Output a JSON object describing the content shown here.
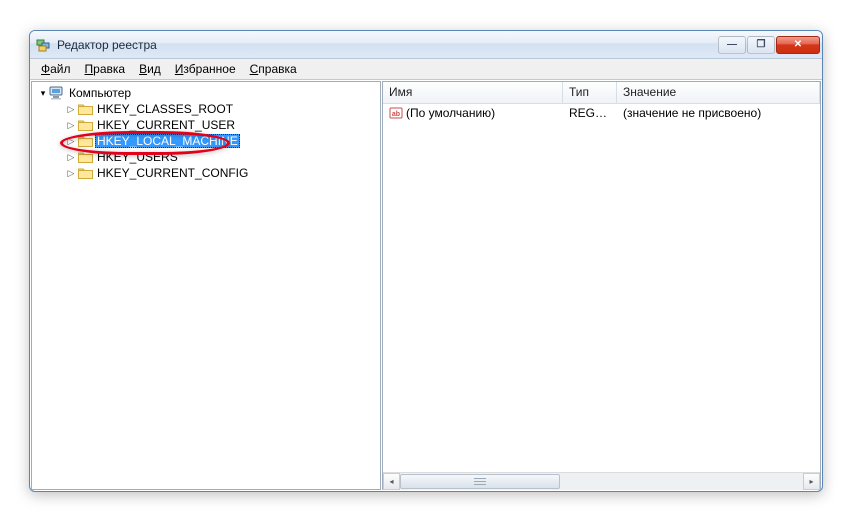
{
  "window": {
    "title": "Редактор реестра"
  },
  "window_controls": {
    "minimize_icon": "—",
    "maximize_icon": "❐",
    "close_icon": "✕"
  },
  "menu": {
    "file": {
      "ul": "Ф",
      "rest": "айл"
    },
    "edit": {
      "ul": "П",
      "rest": "равка"
    },
    "view": {
      "ul": "В",
      "rest": "ид"
    },
    "favorites": {
      "ul": "И",
      "rest": "збранное"
    },
    "help": {
      "ul": "С",
      "rest": "правка"
    }
  },
  "tree": {
    "root": "Компьютер",
    "items": [
      "HKEY_CLASSES_ROOT",
      "HKEY_CURRENT_USER",
      "HKEY_LOCAL_MACHINE",
      "HKEY_USERS",
      "HKEY_CURRENT_CONFIG"
    ],
    "selected_index": 2
  },
  "list": {
    "columns": {
      "name": "Имя",
      "type": "Тип",
      "value": "Значение"
    },
    "rows": [
      {
        "name": "(По умолчанию)",
        "type": "REG_SZ",
        "value": "(значение не присвоено)"
      }
    ]
  }
}
